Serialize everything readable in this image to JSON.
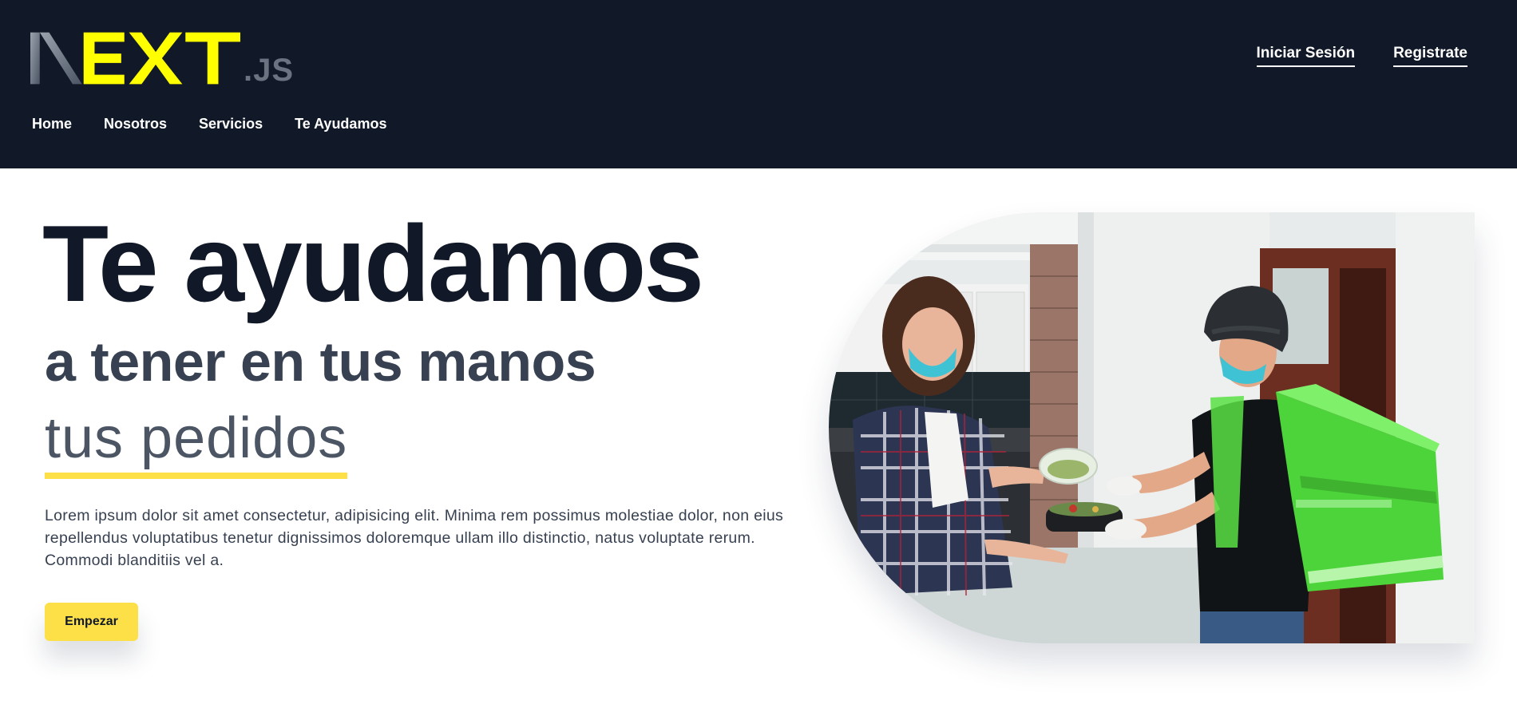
{
  "header": {
    "logo": {
      "text": "NEXT",
      "suffix": ".JS"
    },
    "auth": {
      "login": "Iniciar Sesión",
      "register": "Registrate"
    },
    "nav": [
      {
        "label": "Home"
      },
      {
        "label": "Nosotros"
      },
      {
        "label": "Servicios"
      },
      {
        "label": "Te Ayudamos"
      }
    ]
  },
  "hero": {
    "title": "Te ayudamos",
    "subtitle": "a tener en tus manos",
    "subtitle2": "tus pedidos",
    "description": "Lorem ipsum dolor sit amet consectetur, adipisicing elit. Minima rem possimus molestiae dolor, non eius repellendus voluptatibus tenetur dignissimos doloremque ullam illo distinctio, natus voluptate rerum. Commodi blanditiis vel a.",
    "cta": "Empezar"
  },
  "colors": {
    "header_bg": "#111827",
    "accent": "#fde047",
    "logo_yellow": "#ffff00"
  }
}
